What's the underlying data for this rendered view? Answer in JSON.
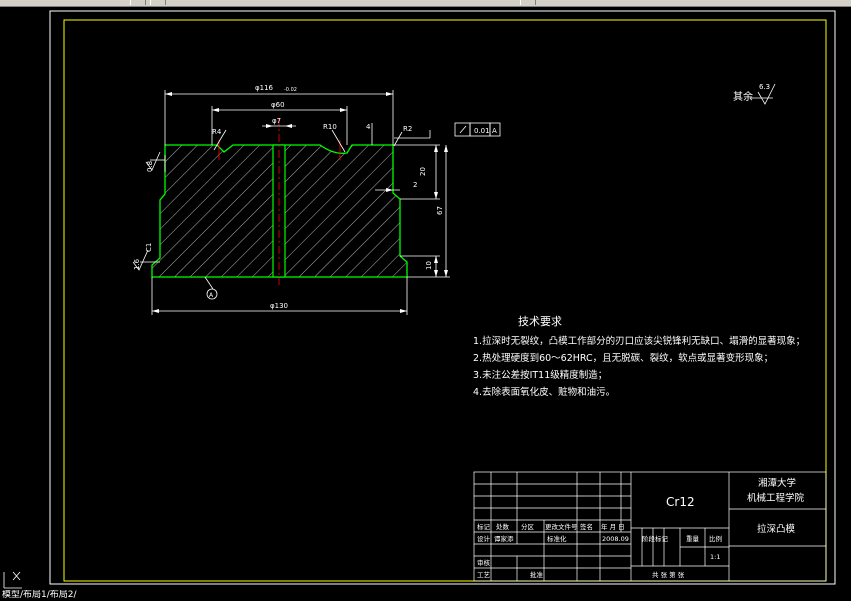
{
  "app": {
    "status_text": "模型/布局1/布局2/"
  },
  "drawing": {
    "roughness_other_label": "其余",
    "roughness_other_value": "6.3",
    "dims": {
      "d116": "φ116",
      "d116_tol": "-0.02",
      "d60": "φ60",
      "d7": "φ7",
      "d130": "φ130",
      "r4": "R4",
      "r10": "R10",
      "r2": "R2",
      "dim4": "4",
      "dim20": "20",
      "dim2": "2",
      "dim67": "67",
      "dim10": "10",
      "c1": "C1",
      "ra08": "0.8",
      "ra16": "1.6",
      "perp_value": "0.01",
      "datum_a": "A",
      "datum_a_marker": "A"
    },
    "tech_title": "技术要求",
    "tech_notes": [
      "1.拉深时无裂纹，凸模工作部分的刃口应该尖锐锋利无缺口、塌滑的显著现象；",
      "2.热处理硬度到60～62HRC，且无脱碳、裂纹，软点或显著变形现象；",
      "3.未注公差按IT11级精度制造；",
      "4.去除表面氧化皮、赃物和油污。"
    ]
  },
  "title_block": {
    "material": "Cr12",
    "university": "湘潭大学",
    "college": "机械工程学院",
    "part_name": "拉深凸模",
    "scale": "1:1",
    "headers": {
      "mark": "标记",
      "count": "处数",
      "zone": "分区",
      "change_doc": "更改文件号",
      "sign": "签名",
      "date": "年 月 日",
      "design": "设计",
      "designer": "谭家添",
      "standardize": "标准化",
      "design_date": "2008.09",
      "stage_mark": "阶段标记",
      "weight": "重量",
      "ratio": "比例",
      "review": "审核",
      "process": "工艺",
      "approve": "批准",
      "sheets": "共  张  第  张"
    }
  }
}
